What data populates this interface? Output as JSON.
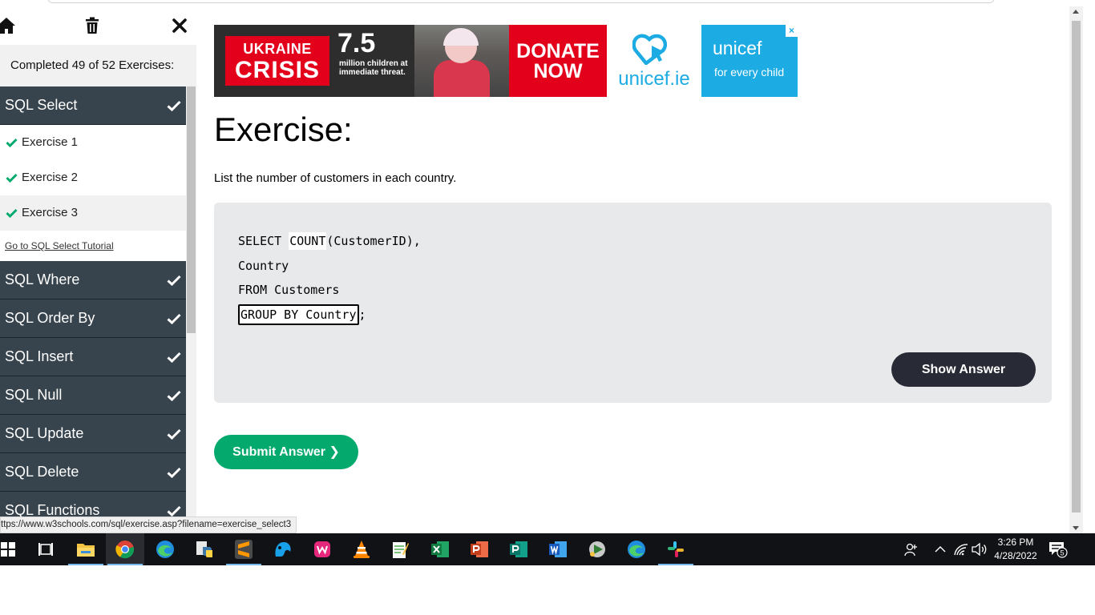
{
  "sidebar": {
    "progress_text": "Completed 49 of 52 Exercises:",
    "categories": [
      {
        "label": "SQL Select",
        "done": true
      },
      {
        "label": "SQL Where",
        "done": true
      },
      {
        "label": "SQL Order By",
        "done": true
      },
      {
        "label": "SQL Insert",
        "done": true
      },
      {
        "label": "SQL Null",
        "done": true
      },
      {
        "label": "SQL Update",
        "done": true
      },
      {
        "label": "SQL Delete",
        "done": true
      },
      {
        "label": "SQL Functions",
        "done": true
      }
    ],
    "exercises": [
      {
        "label": "Exercise 1",
        "done": true
      },
      {
        "label": "Exercise 2",
        "done": true
      },
      {
        "label": "Exercise 3",
        "done": true,
        "active": true
      }
    ],
    "tutorial_link": "Go to SQL Select Tutorial"
  },
  "status_url": "ttps://www.w3schools.com/sql/exercise.asp?filename=exercise_select3",
  "ad": {
    "crisis_line1": "UKRAINE",
    "crisis_line2": "CRISIS",
    "big_number": "7.5",
    "sub_text": "million children at immediate threat.",
    "donate_line1": "DONATE",
    "donate_line2": "NOW",
    "unicef_ie": "unicef.ie",
    "unicef_logo": "unicef",
    "unicef_tagline": "for every child",
    "close_label": "×"
  },
  "exercise": {
    "title": "Exercise:",
    "description": "List the number of customers in each country.",
    "code": {
      "line1_a": "SELECT ",
      "line1_fill": "COUNT",
      "line1_b": "(CustomerID),",
      "line2": "Country",
      "line3": "FROM Customers",
      "line4_blank": "GROUP BY Country",
      "line4_b": ";"
    },
    "show_answer": "Show Answer",
    "submit": "Submit Answer ❯"
  },
  "taskbar": {
    "time": "3:26 PM",
    "date": "4/28/2022",
    "notifications": "5"
  },
  "colors": {
    "sidebar_dark": "#38444d",
    "check_green": "#04aa6d",
    "submit_green": "#04aa6d",
    "show_answer_bg": "#282a35",
    "code_bg": "#e7e9eb",
    "unicef_blue": "#1cabe2",
    "donate_red": "#e3001b"
  }
}
